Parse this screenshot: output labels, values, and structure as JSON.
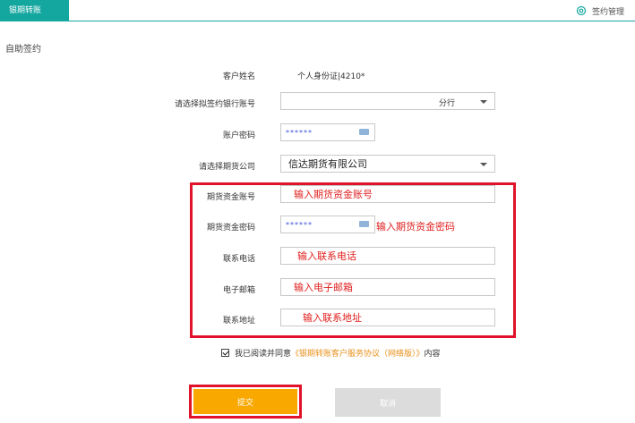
{
  "header": {
    "active_tab": "银期转账",
    "manage_link": "签约管理"
  },
  "section_title": "自助签约",
  "form": {
    "customer_name": {
      "label": "客户姓名",
      "value": "个人身份证|4210*"
    },
    "bank_account": {
      "label": "请选择拟签约银行账号",
      "value": "分行"
    },
    "account_password": {
      "label": "账户密码",
      "value": "******"
    },
    "futures_company": {
      "label": "请选择期货公司",
      "value": "信达期货有限公司"
    },
    "futures_account": {
      "label": "期货资金账号",
      "annotation": "输入期货资金账号"
    },
    "futures_password": {
      "label": "期货资金密码",
      "value": "******",
      "annotation": "输入期货资金密码"
    },
    "phone": {
      "label": "联系电话",
      "annotation": "输入联系电话"
    },
    "email": {
      "label": "电子邮箱",
      "annotation": "输入电子邮箱"
    },
    "address": {
      "label": "联系地址",
      "annotation": "输入联系地址"
    }
  },
  "agreement": {
    "prefix": "我已阅读并同意",
    "link": "《银期转账客户服务协议（网络版）》",
    "suffix": "内容"
  },
  "buttons": {
    "submit": "提交",
    "cancel": "取消"
  },
  "colors": {
    "accent_teal": "#14a7a0",
    "submit_orange": "#f9a800",
    "highlight_red": "#e0132b",
    "link_orange": "#e8911c"
  }
}
